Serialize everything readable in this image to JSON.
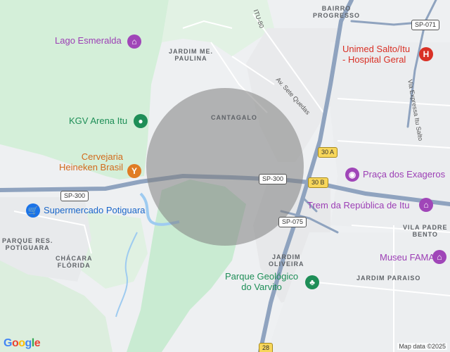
{
  "map": {
    "areas": {
      "bairro_progresso": "BAIRRO\nPROGRESSO",
      "jardim_paulina": "JARDIM ME.\nPAULINA",
      "cantagalo": "CANTAGALO",
      "parque_potiguara": "PARQUE RES.\nPOTIGUARA",
      "chacara_florida": "CHÁCARA\nFLÓRIDA",
      "jardim_oliveira": "JARDIM\nOLIVEIRA",
      "vila_padre_bento": "VILA PADRE\nBENTO",
      "jardim_paraiso": "JARDIM PARAISO"
    },
    "pois": {
      "lago": "Lago Esmeralda",
      "kgv": "KGV Arena Itu",
      "cervejaria": "Cervejaria\nHeineken Brasil",
      "supermercado": "Supermercado Potiguara",
      "unimed": "Unimed Salto/Itu\n- Hospital Geral",
      "praca": "Praça dos Exageros",
      "trem": "Trem da República de Itu",
      "museu": "Museu FAMA",
      "parque_geologico": "Parque Geológico\ndo Varvito"
    },
    "roads": {
      "itu80": "ITU-80",
      "sete_quedas": "Av. Sete Quedas",
      "expressa": "Via Expressa Itu Salto",
      "sp071": "SP-071",
      "sp300_left": "SP-300",
      "sp300_mid": "SP-300",
      "sp075": "SP-075",
      "exit30a": "30 A",
      "exit30b": "30 B",
      "r28": "28"
    },
    "logo": "Google",
    "attribution": "Map data ©2025",
    "colors": {
      "park": "#c9ebd2",
      "highway": "#8fa3bf",
      "water": "#9ecbf0",
      "circle": "#808080"
    }
  }
}
